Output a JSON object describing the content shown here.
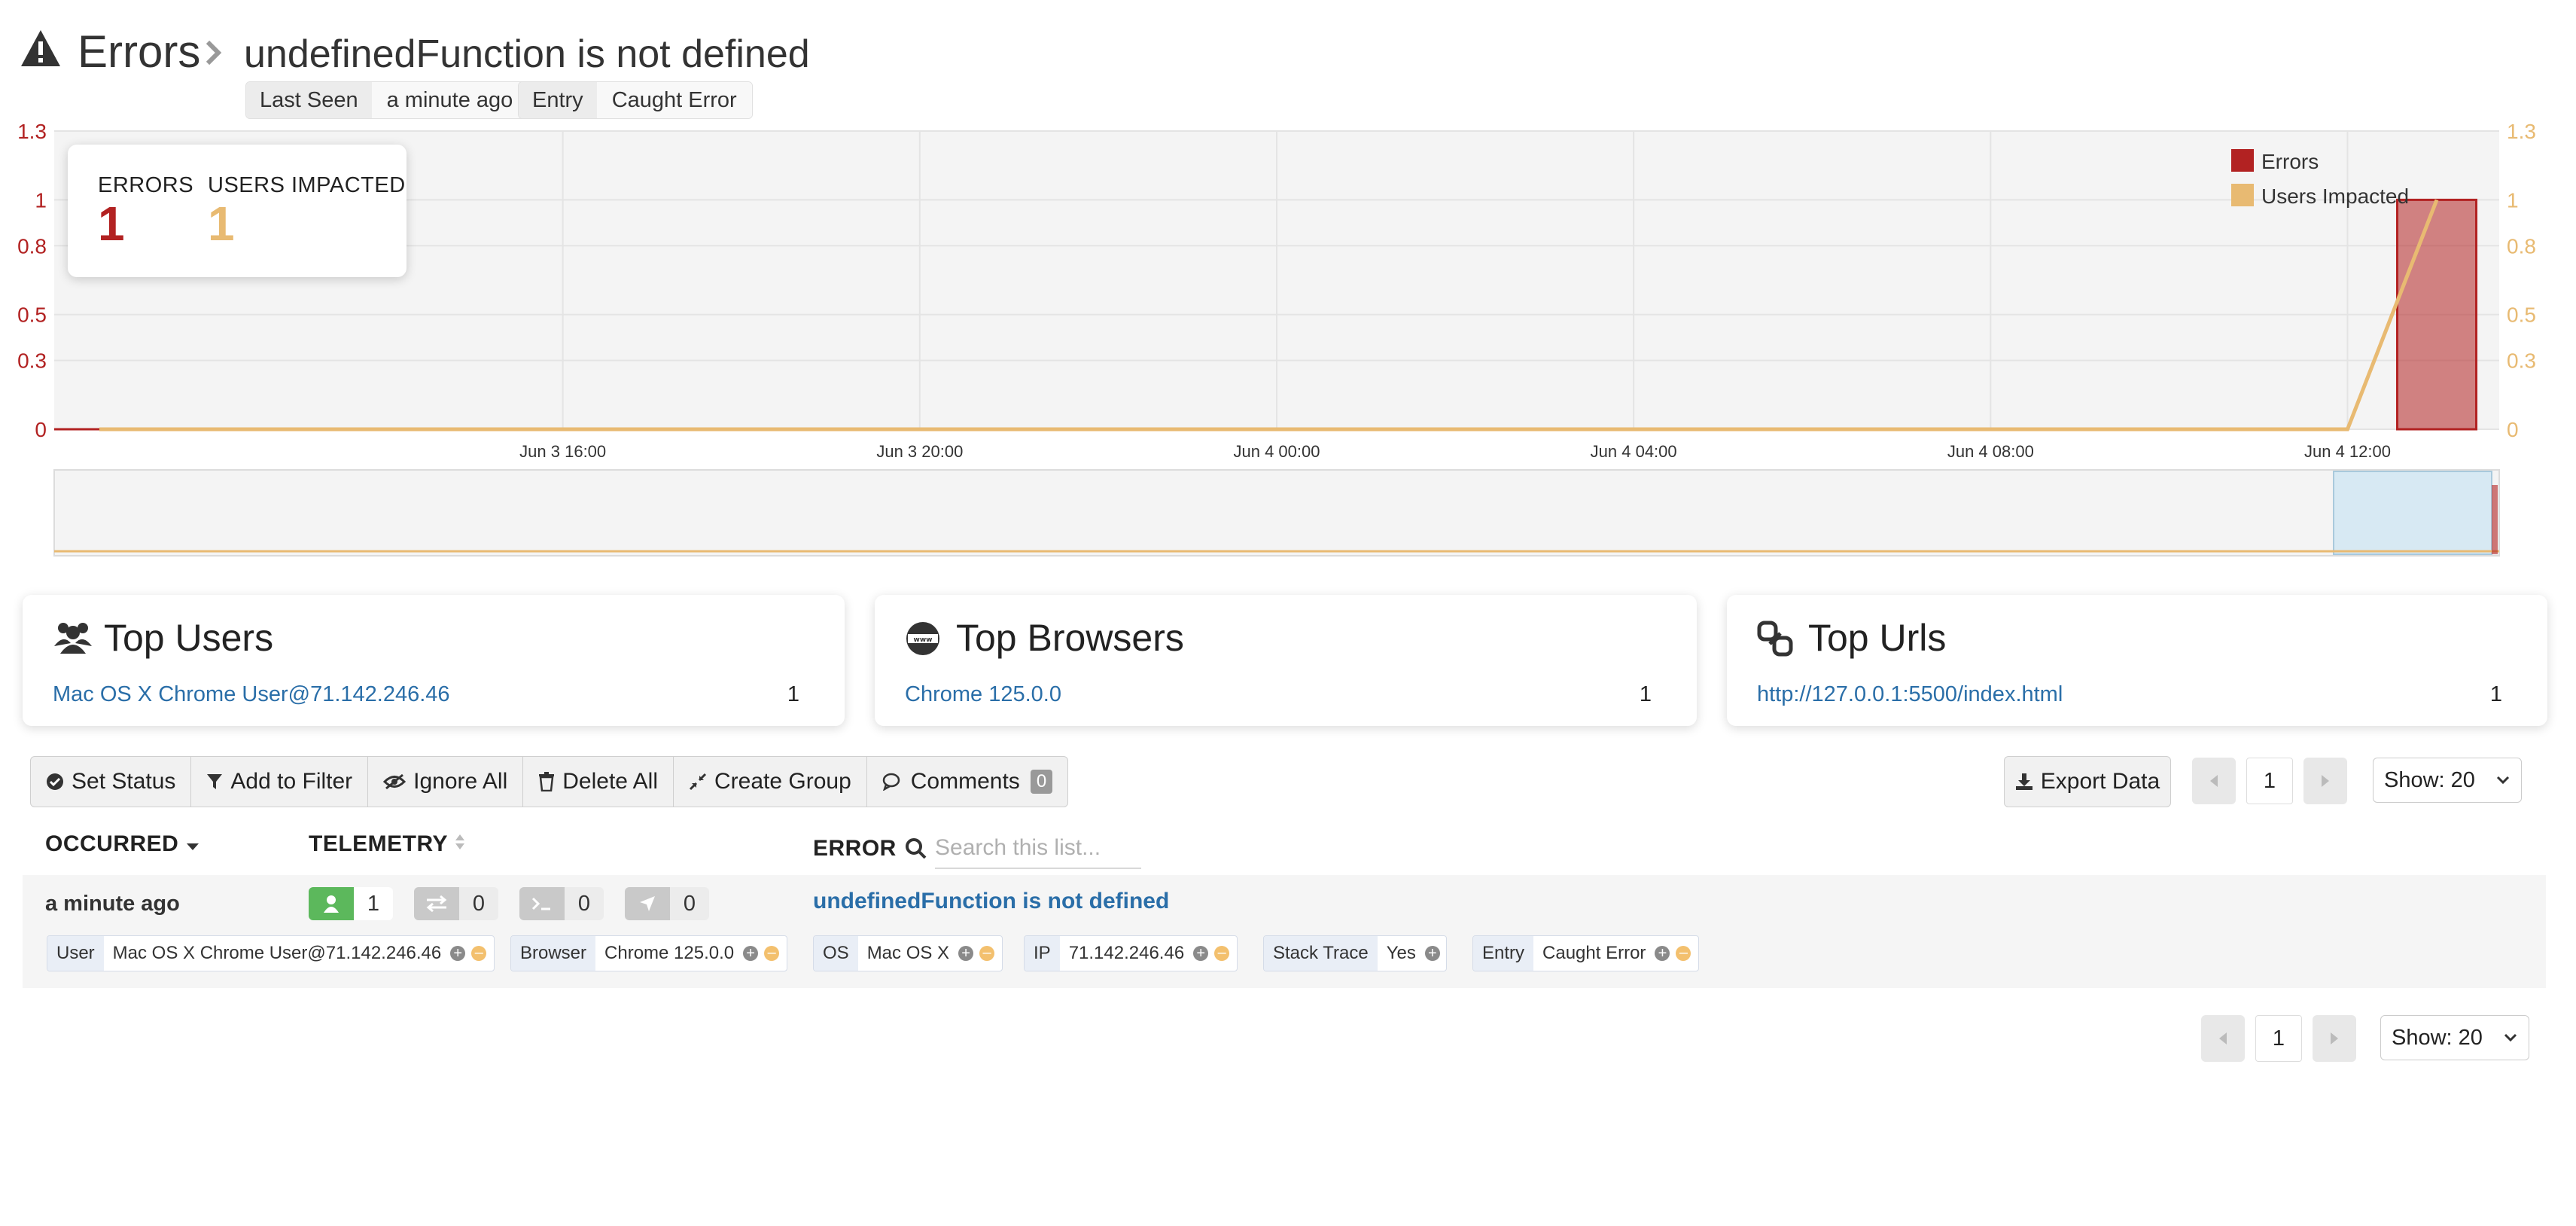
{
  "header": {
    "section": "Errors",
    "error_name": "undefinedFunction is not defined",
    "tags": [
      {
        "key": "Last Seen",
        "value": "a minute ago"
      },
      {
        "key": "Entry",
        "value": "Caught Error"
      }
    ]
  },
  "colors": {
    "errors": "#b22222",
    "users_impacted": "#e8ba72",
    "link": "#2a6ea8"
  },
  "summary": {
    "errors_label": "ERRORS",
    "errors_value": "1",
    "users_label": "USERS IMPACTED",
    "users_value": "1"
  },
  "chart_data": {
    "type": "bar",
    "title": "",
    "x_ticks": [
      "Jun 3 16:00",
      "Jun 3 20:00",
      "Jun 4 00:00",
      "Jun 4 04:00",
      "Jun 4 08:00",
      "Jun 4 12:00"
    ],
    "y_ticks": [
      "0",
      "0.3",
      "0.5",
      "0.8",
      "1",
      "1.3"
    ],
    "ylim": [
      0,
      1.3
    ],
    "legend_position": "top-right",
    "grid": true,
    "series": [
      {
        "name": "Errors",
        "kind": "bar",
        "points": [
          {
            "x": "Jun 4 13:00",
            "y": 1
          }
        ]
      },
      {
        "name": "Users Impacted",
        "kind": "line",
        "points": [
          {
            "x": "Jun 4 12:00",
            "y": 0
          },
          {
            "x": "Jun 4 13:00",
            "y": 1
          }
        ]
      }
    ]
  },
  "top_users": {
    "title": "Top Users",
    "items": [
      {
        "label": "Mac OS X Chrome User@71.142.246.46",
        "count": "1"
      }
    ]
  },
  "top_browsers": {
    "title": "Top Browsers",
    "items": [
      {
        "label": "Chrome 125.0.0",
        "count": "1"
      }
    ]
  },
  "top_urls": {
    "title": "Top Urls",
    "items": [
      {
        "label": "http://127.0.0.1:5500/index.html",
        "count": "1"
      }
    ]
  },
  "toolbar": {
    "set_status": "Set Status",
    "add_to_filter": "Add to Filter",
    "ignore_all": "Ignore All",
    "delete_all": "Delete All",
    "create_group": "Create Group",
    "comments": "Comments",
    "comments_count": "0",
    "export": "Export Data"
  },
  "pagination": {
    "page": "1",
    "show": "Show: 20"
  },
  "table": {
    "col_occurred": "OCCURRED",
    "col_telemetry": "TELEMETRY",
    "col_error": "ERROR",
    "search_placeholder": "Search this list...",
    "rows": [
      {
        "occurred": "a minute ago",
        "telemetry": {
          "user": "1",
          "network": "0",
          "console": "0",
          "navigation": "0"
        },
        "error": "undefinedFunction is not defined",
        "chips": [
          {
            "key": "User",
            "value": "Mac OS X Chrome User@71.142.246.46"
          },
          {
            "key": "Browser",
            "value": "Chrome 125.0.0"
          },
          {
            "key": "OS",
            "value": "Mac OS X"
          },
          {
            "key": "IP",
            "value": "71.142.246.46"
          },
          {
            "key": "Stack Trace",
            "value": "Yes"
          },
          {
            "key": "Entry",
            "value": "Caught Error"
          }
        ]
      }
    ]
  }
}
